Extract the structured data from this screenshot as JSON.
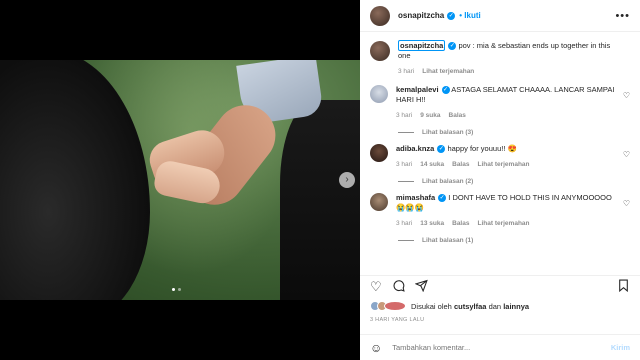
{
  "post": {
    "author": "osnapitzcha",
    "follow_label": "Ikuti",
    "more_label": "•••",
    "next_label": "›",
    "slide_count": 2,
    "active_slide": 1
  },
  "caption": {
    "user": "osnapitzcha",
    "text": "pov : mia & sebastian ends up together in this one",
    "time": "3 hari",
    "translate": "Lihat terjemahan"
  },
  "comments": [
    {
      "user": "kemalpalevi",
      "verified": true,
      "text": "ASTAGA SELAMAT CHAAAA. LANCAR SAMPAI HARI H!!",
      "time": "3 hari",
      "likes": "9 suka",
      "reply": "Balas",
      "translate": "",
      "replies": "Lihat balasan (3)"
    },
    {
      "user": "adiba.knza",
      "verified": true,
      "text": "happy for youuu!! 😍",
      "time": "3 hari",
      "likes": "14 suka",
      "reply": "Balas",
      "translate": "Lihat terjemahan",
      "replies": "Lihat balasan (2)"
    },
    {
      "user": "mimashafa",
      "verified": true,
      "text": "I DONT HAVE TO HOLD THIS IN ANYMOOOOO😭😭😭",
      "time": "3 hari",
      "likes": "13 suka",
      "reply": "Balas",
      "translate": "Lihat terjemahan",
      "replies": "Lihat balasan (1)"
    }
  ],
  "actions": {
    "like_icon": "heart-icon",
    "comment_icon": "comment-icon",
    "share_icon": "share-icon",
    "save_icon": "bookmark-icon"
  },
  "likes": {
    "prefix": "Disukai oleh",
    "user": "cutsylfaa",
    "joiner": "dan",
    "others": "lainnya"
  },
  "date": "3 HARI YANG LALU",
  "add_comment": {
    "placeholder": "Tambahkan komentar...",
    "post_label": "Kirim"
  },
  "colors": {
    "accent": "#0095f6",
    "muted": "#8e8e8e",
    "post_disabled": "#b3dbff"
  }
}
